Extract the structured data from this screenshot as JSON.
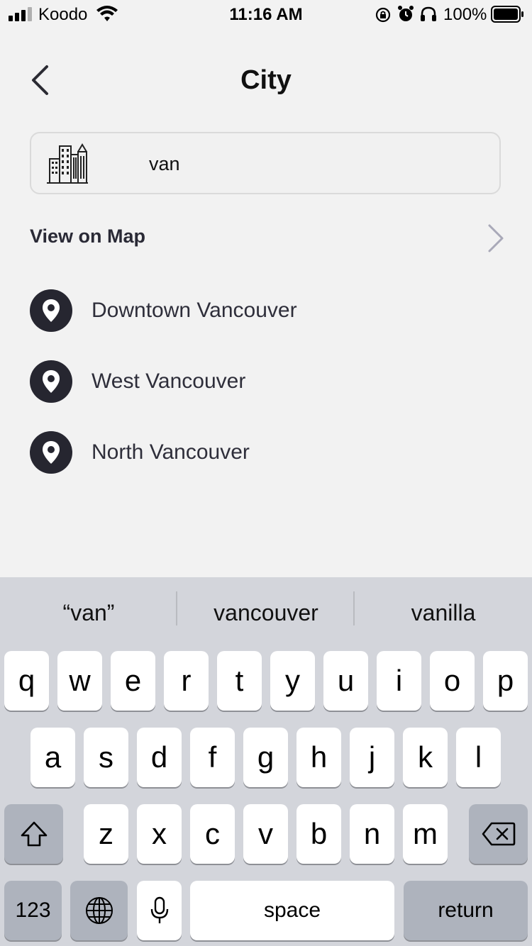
{
  "status_bar": {
    "carrier": "Koodo",
    "time": "11:16 AM",
    "battery_percent": "100%",
    "icons": [
      "signal-icon",
      "wifi-icon",
      "orientation-lock-icon",
      "alarm-icon",
      "headphones-icon",
      "battery-icon"
    ]
  },
  "header": {
    "title": "City",
    "back_icon": "chevron-left-icon"
  },
  "search": {
    "value": "van",
    "icon": "city-buildings-icon"
  },
  "view_on_map": {
    "label": "View on Map",
    "icon": "chevron-right-icon"
  },
  "results": [
    {
      "label": "Downtown Vancouver",
      "icon": "location-pin-icon"
    },
    {
      "label": "West Vancouver",
      "icon": "location-pin-icon"
    },
    {
      "label": "North Vancouver",
      "icon": "location-pin-icon"
    }
  ],
  "keyboard": {
    "suggestions": [
      "“van”",
      "vancouver",
      "vanilla"
    ],
    "row1": [
      "q",
      "w",
      "e",
      "r",
      "t",
      "y",
      "u",
      "i",
      "o",
      "p"
    ],
    "row2": [
      "a",
      "s",
      "d",
      "f",
      "g",
      "h",
      "j",
      "k",
      "l"
    ],
    "row3": [
      "z",
      "x",
      "c",
      "v",
      "b",
      "n",
      "m"
    ],
    "numbers_key": "123",
    "space_key": "space",
    "return_key": "return"
  },
  "colors": {
    "background": "#f2f2f2",
    "text_dark": "#23232f",
    "pin_circle": "#262630",
    "keyboard_bg": "#d3d5db",
    "function_key": "#aeb3bd"
  }
}
